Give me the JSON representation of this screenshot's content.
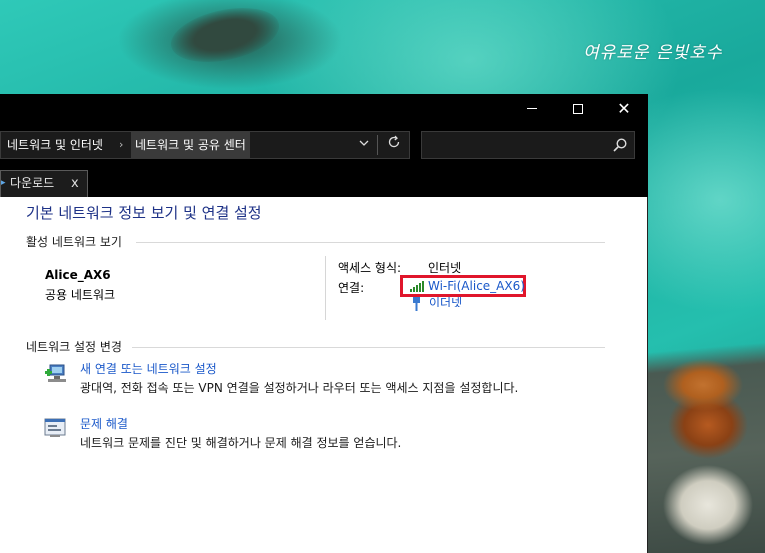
{
  "desktop": {
    "wallpaper_text": "여유로운 은빛호수"
  },
  "window": {
    "controls": {
      "minimize": "minimize",
      "maximize": "maximize",
      "close": "✕"
    },
    "address_bar": {
      "crumbs": [
        "네트워크 및 인터넷",
        "네트워크 및 공유 센터"
      ],
      "separator": "›",
      "dropdown_icon": "chevron-down-icon",
      "refresh_icon": "refresh-icon"
    },
    "search": {
      "placeholder": "",
      "icon": "search-icon"
    },
    "tabs": [
      {
        "label": "다운로드",
        "close": "x"
      }
    ]
  },
  "content": {
    "page_title": "기본 네트워크 정보 보기 및 연결 설정",
    "active_networks": {
      "header": "활성 네트워크 보기",
      "network_name": "Alice_AX6",
      "network_type": "공용 네트워크",
      "access_type_label": "액세스 형식:",
      "access_type_value": "인터넷",
      "connections_label": "연결:",
      "connections": [
        {
          "label": "Wi-Fi(Alice_AX6)",
          "icon": "wifi-signal-icon",
          "highlighted": true,
          "highlight_color": "#e0162b"
        },
        {
          "label": "이더넷",
          "icon": "ethernet-icon",
          "highlighted": false
        }
      ]
    },
    "change_settings": {
      "header": "네트워크 설정 변경",
      "tasks": [
        {
          "title": "새 연결 또는 네트워크 설정",
          "description": "광대역, 전화 접속 또는 VPN 연결을 설정하거나 라우터 또는 액세스 지점을 설정합니다.",
          "icon": "new-connection-icon"
        },
        {
          "title": "문제 해결",
          "description": "네트워크 문제를 진단 및 해결하거나 문제 해결 정보를 얻습니다.",
          "icon": "troubleshoot-icon"
        }
      ]
    }
  },
  "colors": {
    "link": "#1a58c9",
    "title": "#1e3287",
    "titlebar": "#000000",
    "highlight_box": "#e0162b"
  }
}
